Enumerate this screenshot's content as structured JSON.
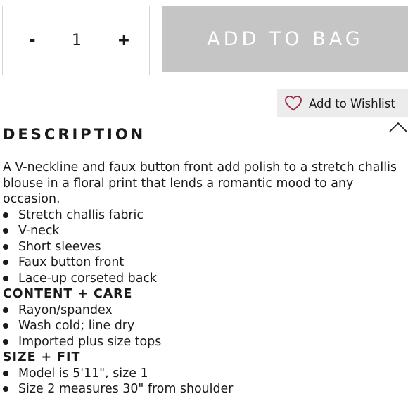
{
  "quantity": {
    "minus_label": "-",
    "value": "1",
    "plus_label": "+"
  },
  "actions": {
    "add_to_bag_label": "ADD TO BAG",
    "wishlist_label": "Add to Wishlist"
  },
  "description": {
    "title": "DESCRIPTION",
    "paragraph": "A V-neckline and faux button front add polish to a stretch challis blouse in a floral print that lends a romantic mood to any occasion.",
    "features": [
      "Stretch challis fabric",
      "V-neck",
      "Short sleeves",
      "Faux button front",
      "Lace-up corseted back"
    ],
    "content_care": {
      "heading": "CONTENT + CARE",
      "items": [
        "Rayon/spandex",
        "Wash cold; line dry",
        "Imported plus size tops"
      ]
    },
    "size_fit": {
      "heading": "SIZE + FIT",
      "items": [
        "Model is 5'11\", size 1",
        "Size 2 measures 30\" from shoulder"
      ]
    }
  },
  "icons": {
    "wishlist": "heart-outline-icon",
    "collapse": "chevron-up-icon"
  },
  "colors": {
    "add_to_bag_bg": "#c5c5c5",
    "wishlist_bg": "#ececec",
    "heart": "#9b2a4a",
    "text": "#1a1a1a"
  }
}
